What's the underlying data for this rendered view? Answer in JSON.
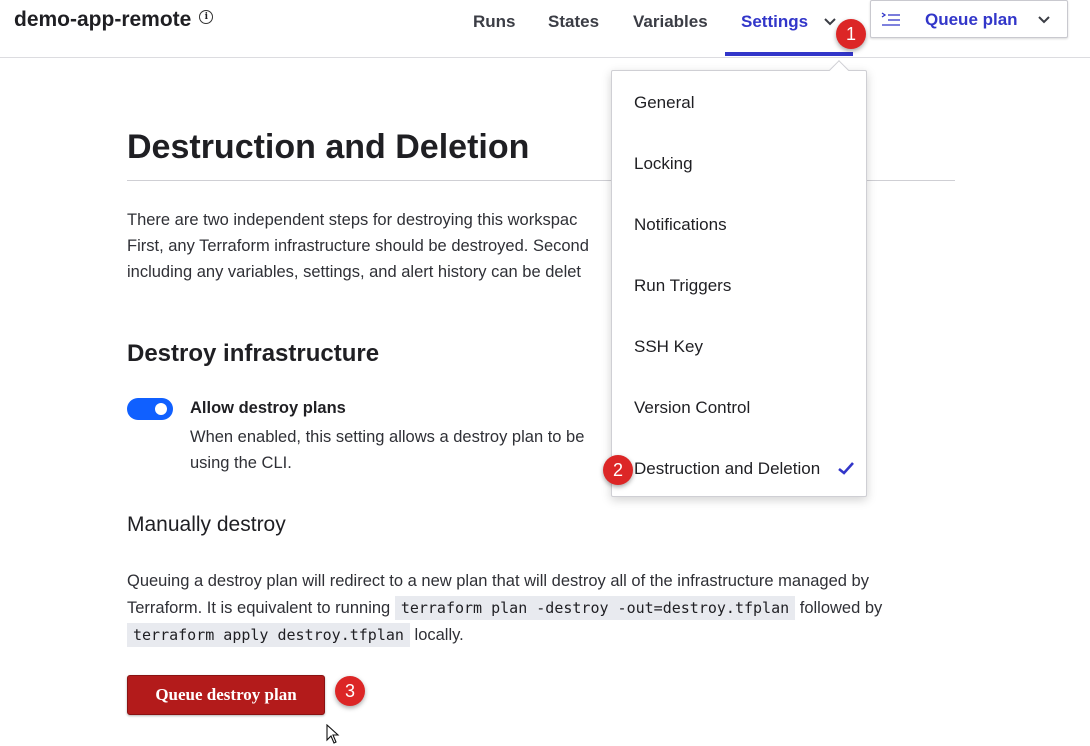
{
  "header": {
    "workspace_name": "demo-app-remote",
    "info_glyph": "i",
    "nav": [
      {
        "label": "Runs"
      },
      {
        "label": "States"
      },
      {
        "label": "Variables"
      },
      {
        "label": "Settings"
      }
    ],
    "queue_plan_label": "Queue plan"
  },
  "settings_menu": {
    "items": [
      {
        "label": "General"
      },
      {
        "label": "Locking"
      },
      {
        "label": "Notifications"
      },
      {
        "label": "Run Triggers"
      },
      {
        "label": "SSH Key"
      },
      {
        "label": "Version Control"
      },
      {
        "label": "Destruction and Deletion",
        "selected": true
      }
    ]
  },
  "main": {
    "title": "Destruction and Deletion",
    "intro_lines": [
      "There are two independent steps for destroying this workspac",
      "First, any Terraform infrastructure should be destroyed. Second",
      "including any variables, settings, and alert history can be delet"
    ],
    "destroy_infra": {
      "heading": "Destroy infrastructure",
      "toggle_on": true,
      "toggle_title": "Allow destroy plans",
      "toggle_desc_lines": [
        "When enabled, this setting allows a destroy plan to be",
        "using the CLI."
      ]
    },
    "manual": {
      "heading": "Manually destroy",
      "line1": "Queuing a destroy plan will redirect to a new plan that will destroy all of the infrastructure managed by",
      "line2_pre": "Terraform. It is equivalent to running",
      "code1": "terraform plan -destroy -out=destroy.tfplan",
      "line2_post": "followed by",
      "code2": "terraform apply destroy.tfplan",
      "line3_post": "locally.",
      "button_label": "Queue destroy plan"
    }
  },
  "annotations": [
    "1",
    "2",
    "3"
  ],
  "colors": {
    "accent": "#3236c9",
    "toggle": "#1060ff",
    "danger": "#b31b1b",
    "badge": "#dc2626"
  }
}
